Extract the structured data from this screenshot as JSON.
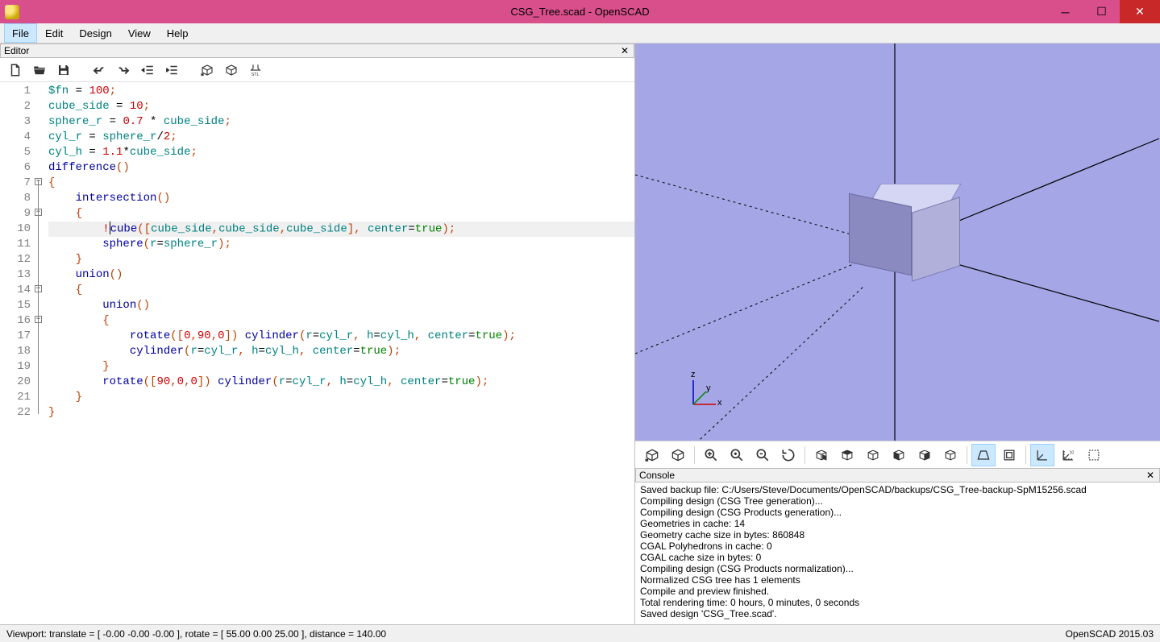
{
  "title": "CSG_Tree.scad - OpenSCAD",
  "menu": {
    "file": "File",
    "edit": "Edit",
    "design": "Design",
    "view": "View",
    "help": "Help"
  },
  "editor_panel": {
    "label": "Editor"
  },
  "code": {
    "lines": [
      {
        "n": "1",
        "pre": "",
        "tokens": [
          {
            "t": "idn",
            "v": "$fn"
          },
          {
            "t": "op",
            "v": " = "
          },
          {
            "t": "num",
            "v": "100"
          },
          {
            "t": "pun",
            "v": ";"
          }
        ]
      },
      {
        "n": "2",
        "pre": "",
        "tokens": [
          {
            "t": "idn",
            "v": "cube_side"
          },
          {
            "t": "op",
            "v": " = "
          },
          {
            "t": "num",
            "v": "10"
          },
          {
            "t": "pun",
            "v": ";"
          }
        ]
      },
      {
        "n": "3",
        "pre": "",
        "tokens": [
          {
            "t": "idn",
            "v": "sphere_r"
          },
          {
            "t": "op",
            "v": " = "
          },
          {
            "t": "num",
            "v": "0.7"
          },
          {
            "t": "op",
            "v": " * "
          },
          {
            "t": "idn",
            "v": "cube_side"
          },
          {
            "t": "pun",
            "v": ";"
          }
        ]
      },
      {
        "n": "4",
        "pre": "",
        "tokens": [
          {
            "t": "idn",
            "v": "cyl_r"
          },
          {
            "t": "op",
            "v": " = "
          },
          {
            "t": "idn",
            "v": "sphere_r"
          },
          {
            "t": "op",
            "v": "/"
          },
          {
            "t": "num",
            "v": "2"
          },
          {
            "t": "pun",
            "v": ";"
          }
        ]
      },
      {
        "n": "5",
        "pre": "",
        "tokens": [
          {
            "t": "idn",
            "v": "cyl_h"
          },
          {
            "t": "op",
            "v": " = "
          },
          {
            "t": "num",
            "v": "1.1"
          },
          {
            "t": "op",
            "v": "*"
          },
          {
            "t": "idn",
            "v": "cube_side"
          },
          {
            "t": "pun",
            "v": ";"
          }
        ]
      },
      {
        "n": "6",
        "pre": "",
        "tokens": [
          {
            "t": "fn",
            "v": "difference"
          },
          {
            "t": "pun",
            "v": "()"
          }
        ]
      },
      {
        "n": "7",
        "pre": "",
        "fold": true,
        "tokens": [
          {
            "t": "pun",
            "v": "{"
          }
        ]
      },
      {
        "n": "8",
        "pre": "    ",
        "tokens": [
          {
            "t": "fn",
            "v": "intersection"
          },
          {
            "t": "pun",
            "v": "()"
          }
        ]
      },
      {
        "n": "9",
        "pre": "    ",
        "fold": true,
        "tokens": [
          {
            "t": "pun",
            "v": "{"
          }
        ]
      },
      {
        "n": "10",
        "pre": "        ",
        "hl": true,
        "caret": true,
        "tokens": [
          {
            "t": "bang",
            "v": "!"
          },
          {
            "t": "fn",
            "v": "cube"
          },
          {
            "t": "pun",
            "v": "(["
          },
          {
            "t": "idn",
            "v": "cube_side"
          },
          {
            "t": "pun",
            "v": ","
          },
          {
            "t": "idn",
            "v": "cube_side"
          },
          {
            "t": "pun",
            "v": ","
          },
          {
            "t": "idn",
            "v": "cube_side"
          },
          {
            "t": "pun",
            "v": "], "
          },
          {
            "t": "idn",
            "v": "center"
          },
          {
            "t": "op",
            "v": "="
          },
          {
            "t": "kw",
            "v": "true"
          },
          {
            "t": "pun",
            "v": ");"
          }
        ]
      },
      {
        "n": "11",
        "pre": "        ",
        "tokens": [
          {
            "t": "fn",
            "v": "sphere"
          },
          {
            "t": "pun",
            "v": "("
          },
          {
            "t": "idn",
            "v": "r"
          },
          {
            "t": "op",
            "v": "="
          },
          {
            "t": "idn",
            "v": "sphere_r"
          },
          {
            "t": "pun",
            "v": ");"
          }
        ]
      },
      {
        "n": "12",
        "pre": "    ",
        "tokens": [
          {
            "t": "pun",
            "v": "}"
          }
        ]
      },
      {
        "n": "13",
        "pre": "    ",
        "tokens": [
          {
            "t": "fn",
            "v": "union"
          },
          {
            "t": "pun",
            "v": "()"
          }
        ]
      },
      {
        "n": "14",
        "pre": "    ",
        "fold": true,
        "tokens": [
          {
            "t": "pun",
            "v": "{"
          }
        ]
      },
      {
        "n": "15",
        "pre": "        ",
        "tokens": [
          {
            "t": "fn",
            "v": "union"
          },
          {
            "t": "pun",
            "v": "()"
          }
        ]
      },
      {
        "n": "16",
        "pre": "        ",
        "fold": true,
        "tokens": [
          {
            "t": "pun",
            "v": "{"
          }
        ]
      },
      {
        "n": "17",
        "pre": "            ",
        "tokens": [
          {
            "t": "fn",
            "v": "rotate"
          },
          {
            "t": "pun",
            "v": "(["
          },
          {
            "t": "num",
            "v": "0"
          },
          {
            "t": "pun",
            "v": ","
          },
          {
            "t": "num",
            "v": "90"
          },
          {
            "t": "pun",
            "v": ","
          },
          {
            "t": "num",
            "v": "0"
          },
          {
            "t": "pun",
            "v": "]) "
          },
          {
            "t": "fn",
            "v": "cylinder"
          },
          {
            "t": "pun",
            "v": "("
          },
          {
            "t": "idn",
            "v": "r"
          },
          {
            "t": "op",
            "v": "="
          },
          {
            "t": "idn",
            "v": "cyl_r"
          },
          {
            "t": "pun",
            "v": ", "
          },
          {
            "t": "idn",
            "v": "h"
          },
          {
            "t": "op",
            "v": "="
          },
          {
            "t": "idn",
            "v": "cyl_h"
          },
          {
            "t": "pun",
            "v": ", "
          },
          {
            "t": "idn",
            "v": "center"
          },
          {
            "t": "op",
            "v": "="
          },
          {
            "t": "kw",
            "v": "true"
          },
          {
            "t": "pun",
            "v": ");"
          }
        ]
      },
      {
        "n": "18",
        "pre": "            ",
        "tokens": [
          {
            "t": "fn",
            "v": "cylinder"
          },
          {
            "t": "pun",
            "v": "("
          },
          {
            "t": "idn",
            "v": "r"
          },
          {
            "t": "op",
            "v": "="
          },
          {
            "t": "idn",
            "v": "cyl_r"
          },
          {
            "t": "pun",
            "v": ", "
          },
          {
            "t": "idn",
            "v": "h"
          },
          {
            "t": "op",
            "v": "="
          },
          {
            "t": "idn",
            "v": "cyl_h"
          },
          {
            "t": "pun",
            "v": ", "
          },
          {
            "t": "idn",
            "v": "center"
          },
          {
            "t": "op",
            "v": "="
          },
          {
            "t": "kw",
            "v": "true"
          },
          {
            "t": "pun",
            "v": ");"
          }
        ]
      },
      {
        "n": "19",
        "pre": "        ",
        "tokens": [
          {
            "t": "pun",
            "v": "}"
          }
        ]
      },
      {
        "n": "20",
        "pre": "        ",
        "tokens": [
          {
            "t": "fn",
            "v": "rotate"
          },
          {
            "t": "pun",
            "v": "(["
          },
          {
            "t": "num",
            "v": "90"
          },
          {
            "t": "pun",
            "v": ","
          },
          {
            "t": "num",
            "v": "0"
          },
          {
            "t": "pun",
            "v": ","
          },
          {
            "t": "num",
            "v": "0"
          },
          {
            "t": "pun",
            "v": "]) "
          },
          {
            "t": "fn",
            "v": "cylinder"
          },
          {
            "t": "pun",
            "v": "("
          },
          {
            "t": "idn",
            "v": "r"
          },
          {
            "t": "op",
            "v": "="
          },
          {
            "t": "idn",
            "v": "cyl_r"
          },
          {
            "t": "pun",
            "v": ", "
          },
          {
            "t": "idn",
            "v": "h"
          },
          {
            "t": "op",
            "v": "="
          },
          {
            "t": "idn",
            "v": "cyl_h"
          },
          {
            "t": "pun",
            "v": ", "
          },
          {
            "t": "idn",
            "v": "center"
          },
          {
            "t": "op",
            "v": "="
          },
          {
            "t": "kw",
            "v": "true"
          },
          {
            "t": "pun",
            "v": ");"
          }
        ]
      },
      {
        "n": "21",
        "pre": "    ",
        "tokens": [
          {
            "t": "pun",
            "v": "}"
          }
        ]
      },
      {
        "n": "22",
        "pre": "",
        "tokens": [
          {
            "t": "pun",
            "v": "}"
          }
        ]
      }
    ]
  },
  "viewport_axes": {
    "z": "z",
    "y": "y",
    "x": "x"
  },
  "console_panel": {
    "label": "Console"
  },
  "console": [
    "Saved backup file: C:/Users/Steve/Documents/OpenSCAD/backups/CSG_Tree-backup-SpM15256.scad",
    "Compiling design (CSG Tree generation)...",
    "Compiling design (CSG Products generation)...",
    "Geometries in cache: 14",
    "Geometry cache size in bytes: 860848",
    "CGAL Polyhedrons in cache: 0",
    "CGAL cache size in bytes: 0",
    "Compiling design (CSG Products normalization)...",
    "Normalized CSG tree has 1 elements",
    "Compile and preview finished.",
    "Total rendering time: 0 hours, 0 minutes, 0 seconds",
    "Saved design 'CSG_Tree.scad'."
  ],
  "status": {
    "left": "Viewport: translate = [ -0.00 -0.00 -0.00 ], rotate = [ 55.00 0.00 25.00 ], distance = 140.00",
    "right": "OpenSCAD 2015.03"
  }
}
